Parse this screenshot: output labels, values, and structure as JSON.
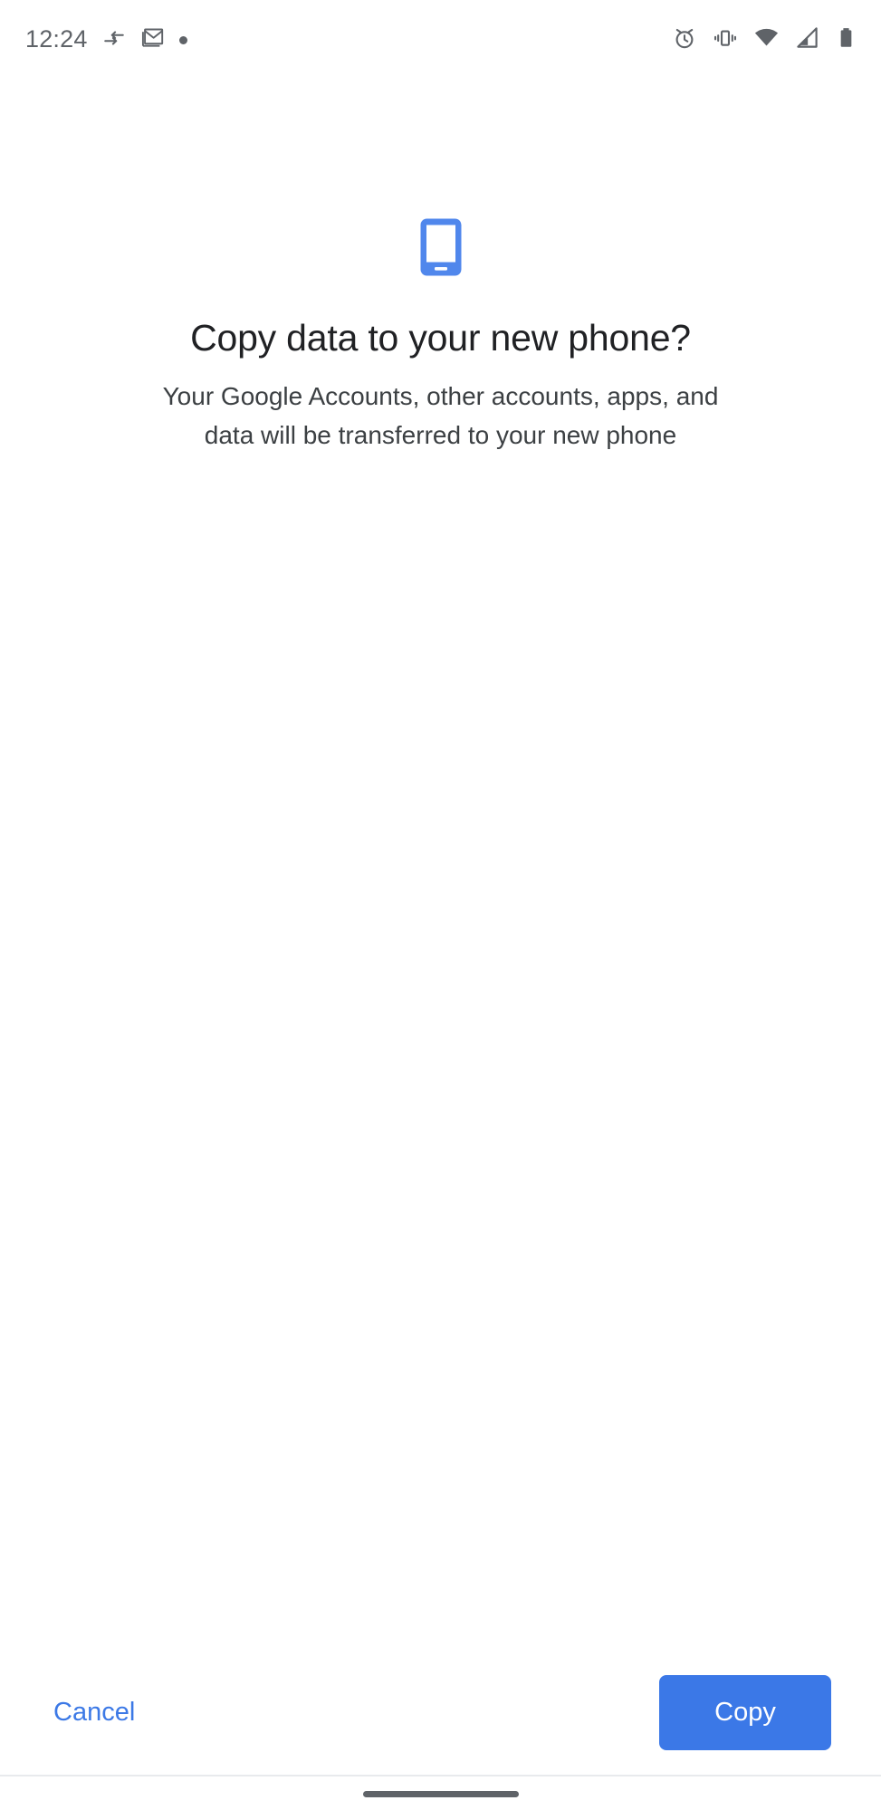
{
  "status_bar": {
    "time": "12:24",
    "left_icons": [
      {
        "name": "data-transfer-icon",
        "label": "Data transfer"
      },
      {
        "name": "gmail-icon",
        "label": "Gmail"
      },
      {
        "name": "notification-dot-icon",
        "label": "Notification"
      }
    ],
    "right_icons": [
      {
        "name": "alarm-icon",
        "label": "Alarm set"
      },
      {
        "name": "vibrate-icon",
        "label": "Ringer vibrate"
      },
      {
        "name": "wifi-icon",
        "label": "Wi-Fi connected"
      },
      {
        "name": "cellular-signal-icon",
        "label": "Mobile signal"
      },
      {
        "name": "battery-icon",
        "label": "Battery full"
      }
    ]
  },
  "main": {
    "illustration": "phone-icon",
    "title": "Copy data to your new phone?",
    "subtitle": "Your Google Accounts, other accounts, apps, and data will be transferred to your new phone"
  },
  "actions": {
    "cancel_label": "Cancel",
    "copy_label": "Copy"
  },
  "colors": {
    "accent_blue": "#3b78e7",
    "illustration_blue": "#5087ec",
    "link_blue": "#3c79e6",
    "title_text": "#202124",
    "body_text": "#3c4043",
    "status_icon": "#5f6368",
    "divider": "#e8eaed",
    "background": "#ffffff"
  }
}
